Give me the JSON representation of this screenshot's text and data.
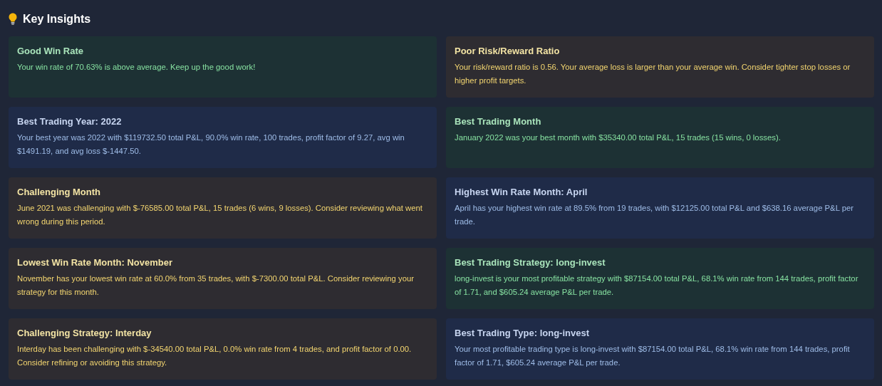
{
  "heading": "Key Insights",
  "insights": [
    {
      "kind": "success",
      "title": "Good Win Rate",
      "text": "Your win rate of 70.63% is above average. Keep up the good work!"
    },
    {
      "kind": "warning",
      "title": "Poor Risk/Reward Ratio",
      "text": "Your risk/reward ratio is 0.56. Your average loss is larger than your average win. Consider tighter stop losses or higher profit targets."
    },
    {
      "kind": "info",
      "title": "Best Trading Year: 2022",
      "text": "Your best year was 2022 with $119732.50 total P&L, 90.0% win rate, 100 trades, profit factor of 9.27, avg win $1491.19, and avg loss $-1447.50."
    },
    {
      "kind": "success",
      "title": "Best Trading Month",
      "text": "January 2022 was your best month with $35340.00 total P&L, 15 trades (15 wins, 0 losses)."
    },
    {
      "kind": "warning",
      "title": "Challenging Month",
      "text": "June 2021 was challenging with $-76585.00 total P&L, 15 trades (6 wins, 9 losses). Consider reviewing what went wrong during this period."
    },
    {
      "kind": "info",
      "title": "Highest Win Rate Month: April",
      "text": "April has your highest win rate at 89.5% from 19 trades, with $12125.00 total P&L and $638.16 average P&L per trade."
    },
    {
      "kind": "warning",
      "title": "Lowest Win Rate Month: November",
      "text": "November has your lowest win rate at 60.0% from 35 trades, with $-7300.00 total P&L. Consider reviewing your strategy for this month."
    },
    {
      "kind": "success",
      "title": "Best Trading Strategy: long-invest",
      "text": "long-invest is your most profitable strategy with $87154.00 total P&L, 68.1% win rate from 144 trades, profit factor of 1.71, and $605.24 average P&L per trade."
    },
    {
      "kind": "warning",
      "title": "Challenging Strategy: Interday",
      "text": "Interday has been challenging with $-34540.00 total P&L, 0.0% win rate from 4 trades, and profit factor of 0.00. Consider refining or avoiding this strategy."
    },
    {
      "kind": "info",
      "title": "Best Trading Type: long-invest",
      "text": "Your most profitable trading type is long-invest with $87154.00 total P&L, 68.1% win rate from 144 trades, profit factor of 1.71, $605.24 average P&L per trade."
    }
  ]
}
